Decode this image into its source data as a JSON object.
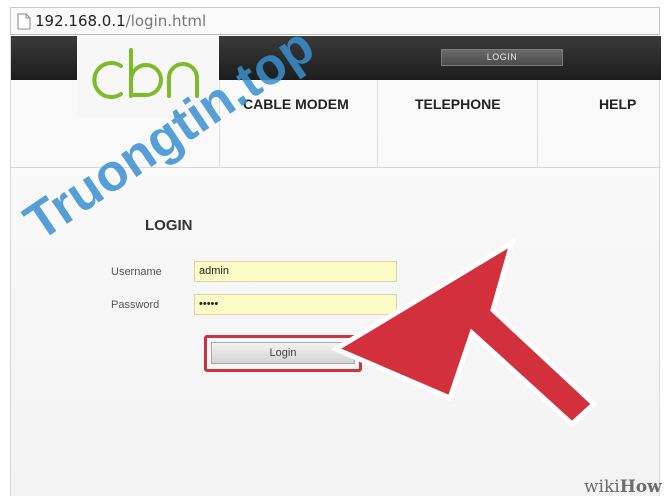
{
  "browser": {
    "url_host": "192.168.0.1",
    "url_path": "/login.html"
  },
  "header": {
    "top_login_label": "LOGIN",
    "logo_text": "cbn"
  },
  "nav": {
    "items": [
      {
        "label": "CABLE MODEM"
      },
      {
        "label": "TELEPHONE"
      },
      {
        "label": "HELP"
      }
    ]
  },
  "login_form": {
    "title": "LOGIN",
    "username_label": "Username",
    "username_value": "admin",
    "password_label": "Password",
    "password_value": "•••••",
    "submit_label": "Login"
  },
  "overlay": {
    "watermark_text": "Truongtin.top",
    "credit_prefix": "wiki",
    "credit_suffix": "How",
    "arrow_color": "#d1303c",
    "highlight_color": "#c9343f"
  }
}
